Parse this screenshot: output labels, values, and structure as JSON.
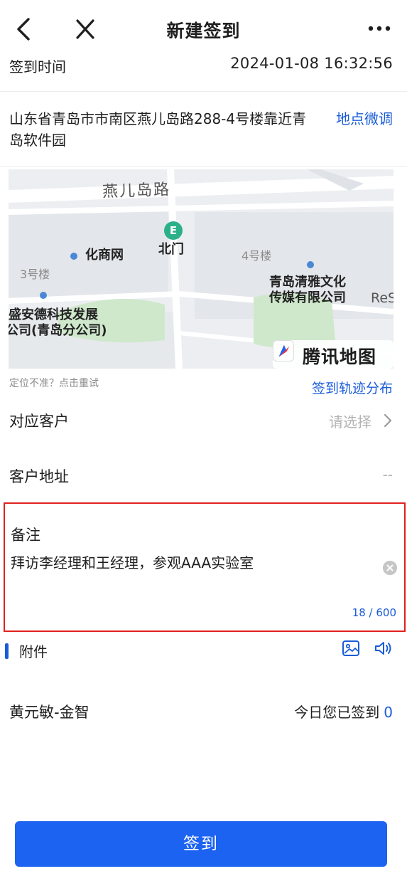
{
  "header": {
    "title": "新建签到",
    "back_icon": "chevron-left-icon",
    "close_icon": "close-icon",
    "more_icon": "more-horizontal-icon"
  },
  "checkin": {
    "time_label": "签到时间",
    "time_value": "2024-01-08 16:32:56",
    "address": "山东省青岛市市南区燕儿岛路288-4号楼靠近青岛软件园",
    "adjust_label": "地点微调"
  },
  "map": {
    "labels": {
      "road": "燕儿岛路",
      "poi_huashang": "化商网",
      "north_gate": "北门",
      "building_3": "3号楼",
      "building_4": "4号楼",
      "company_qingya_1": "青岛清雅文化",
      "company_qingya_2": "传媒有限公司",
      "company_shengan_1": "盛安德科技发展",
      "company_shengan_2": "公司(青岛分公司)",
      "edge_res": "ReS"
    },
    "brand": "腾讯地图",
    "metro_symbol": "E"
  },
  "location": {
    "retry_text": "定位不准？点击重试",
    "trail_link": "签到轨迹分布"
  },
  "customer": {
    "label": "对应客户",
    "placeholder": "请选择"
  },
  "customer_address": {
    "label": "客户地址",
    "value": "--"
  },
  "note": {
    "label": "备注",
    "value": "拜访李经理和王经理，参观AAA实验室",
    "count": "18 / 600"
  },
  "attachments": {
    "label": "附件",
    "image_icon": "image-icon",
    "audio_icon": "speaker-icon"
  },
  "footer_info": {
    "user": "黄元敏-金智",
    "today_label": "今日您已签到",
    "today_count": "0"
  },
  "submit_label": "签到",
  "colors": {
    "accent": "#1a5cd8",
    "button": "#1c63f2",
    "highlight_border": "#e02020"
  }
}
